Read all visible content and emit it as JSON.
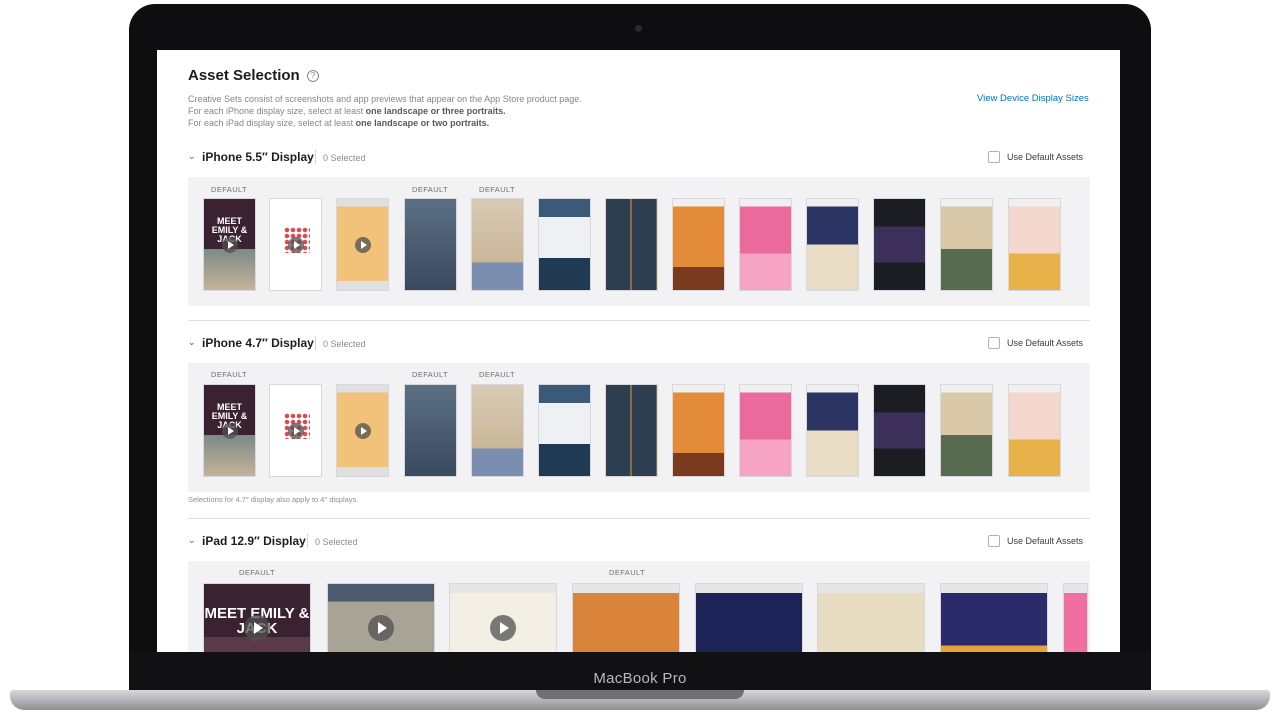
{
  "device": {
    "brand": "MacBook Pro"
  },
  "page": {
    "title": "Asset Selection",
    "help_icon": "?",
    "description_line1": "Creative Sets consist of screenshots and app previews that appear on the App Store product page.",
    "description_line2_prefix": "For each iPhone display size, select at least ",
    "description_line2_bold": "one landscape or three portraits.",
    "description_line3_prefix": "For each iPad display size, select at least ",
    "description_line3_bold": "one landscape or two portraits.",
    "view_sizes_link": "View Device Display Sizes"
  },
  "sections": [
    {
      "title": "iPhone 5.5″ Display",
      "selected": "0 Selected",
      "use_default": "Use Default Assets",
      "default_label": "DEFAULT"
    },
    {
      "title": "iPhone 4.7″ Display",
      "selected": "0 Selected",
      "use_default": "Use Default Assets",
      "default_label": "DEFAULT",
      "note": "Selections for 4.7″ display also apply to 4″ displays."
    },
    {
      "title": "iPad 12.9″ Display",
      "selected": "0 Selected",
      "use_default": "Use Default Assets",
      "default_label": "DEFAULT"
    }
  ],
  "thumb_text": {
    "emily": "MEET EMILY & JACK",
    "emily_short": "EMILY & JACK"
  },
  "colors": {
    "link": "#0070c9",
    "tray": "#f2f2f4"
  }
}
